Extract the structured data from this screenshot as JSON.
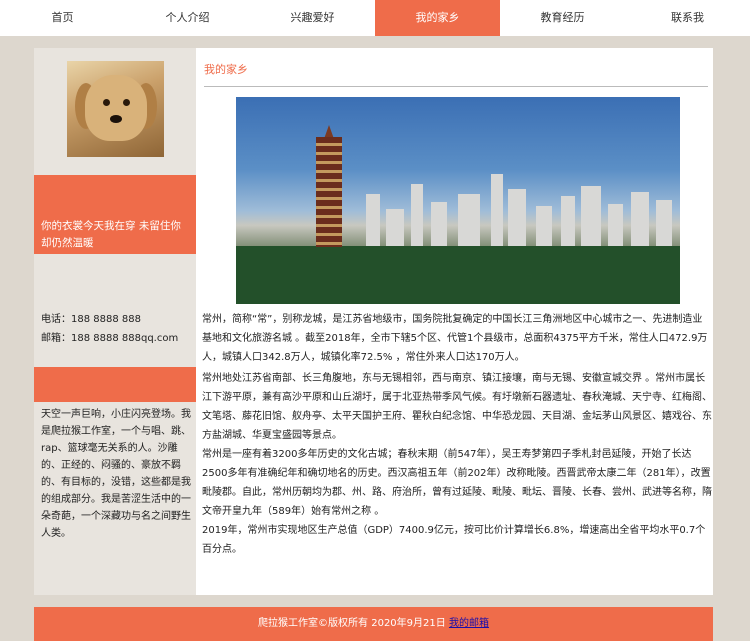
{
  "nav": {
    "items": [
      "首页",
      "个人介绍",
      "兴趣爱好",
      "我的家乡",
      "教育经历",
      "联系我"
    ]
  },
  "sidebar": {
    "quote": "你的衣裳今天我在穿 未留住你却仍然温暖",
    "phone": "电话：188 8888 888",
    "email": "邮箱：188 8888 888qq.com",
    "intro": "天空一声巨响，小庄闪亮登场。我是爬拉猴工作室，一个与唱、跳、rap、篮球毫无关系的人。沙雕的、正经的、闷骚的、豪放不羁的、有目标的，没错，这些都是我的组成部分。我是苦涩生活中的一朵奇葩，一个深藏功与名之间野生人类。"
  },
  "main": {
    "title": "我的家乡",
    "paragraphs": [
      "常州，简称“常”，别称龙城，是江苏省地级市，国务院批复确定的中国长江三角洲地区中心城市之一、先进制造业基地和文化旅游名城 。截至2018年，全市下辖5个区、代管1个县级市，总面积4375平方千米，常住人口472.9万人，城镇人口342.8万人，城镇化率72.5% ，常住外来人口达170万人。",
      "常州地处江苏省南部、长三角腹地，东与无锡相邻，西与南京、镇江接壤，南与无锡、安徽宣城交界 。常州市属长江下游平原，兼有高沙平原和山丘湖圩，属于北亚热带季风气候。有圩墩新石器遗址、春秋淹城、天宁寺、红梅阁、文笔塔、藤花旧馆、舣舟亭、太平天国护王府、瞿秋白纪念馆、中华恐龙园、天目湖、金坛茅山风景区、嬉戏谷、东方盐湖城、华夏宝盛园等景点。",
      "常州是一座有着3200多年历史的文化古城；春秋末期（前547年），吴王寿梦第四子季札封邑延陵，开始了长达2500多年有准确纪年和确切地名的历史。西汉高祖五年（前202年）改称毗陵。西晋武帝太康二年（281年），改置毗陵郡。自此，常州历朝均为郡、州、路、府治所，曾有过延陵、毗陵、毗坛、晋陵、长春、尝州、武进等名称，隋文帝开皇九年（589年）始有常州之称 。",
      "2019年，常州市实现地区生产总值（GDP）7400.9亿元，按可比价计算增长6.8%，增速高出全省平均水平0.7个百分点。"
    ]
  },
  "footer": {
    "text": "爬拉猴工作室©版权所有  2020年9月21日  ",
    "link": "我的邮箱"
  }
}
